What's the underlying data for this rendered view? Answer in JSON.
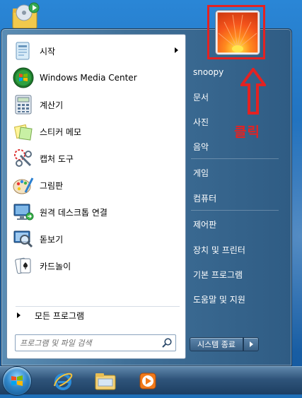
{
  "programs": [
    {
      "label": "시작",
      "has_submenu": true,
      "icon": "startup-folder-icon"
    },
    {
      "label": "Windows Media Center",
      "icon": "windows-media-center-icon"
    },
    {
      "label": "계산기",
      "icon": "calculator-icon"
    },
    {
      "label": "스티커 메모",
      "icon": "sticky-notes-icon"
    },
    {
      "label": "캡처 도구",
      "icon": "snipping-tool-icon"
    },
    {
      "label": "그림판",
      "icon": "paint-icon"
    },
    {
      "label": "원격 데스크톱 연결",
      "icon": "remote-desktop-icon"
    },
    {
      "label": "돋보기",
      "icon": "magnifier-icon"
    },
    {
      "label": "카드놀이",
      "icon": "solitaire-icon"
    }
  ],
  "all_programs_label": "모든 프로그램",
  "search": {
    "placeholder": "프로그램 및 파일 검색"
  },
  "right_items": [
    {
      "label": "snoopy"
    },
    {
      "label": "문서"
    },
    {
      "label": "사진"
    },
    {
      "label": "음악"
    },
    {
      "label": "게임"
    },
    {
      "label": "컴퓨터"
    },
    {
      "label": "제어판"
    },
    {
      "label": "장치 및 프린터"
    },
    {
      "label": "기본 프로그램"
    },
    {
      "label": "도움말 및 지원"
    }
  ],
  "shutdown_label": "시스템 종료",
  "annotation": {
    "label": "클릭",
    "color": "#e32222"
  },
  "taskbar_items": [
    "internet-explorer-icon",
    "windows-explorer-icon",
    "media-player-icon"
  ]
}
